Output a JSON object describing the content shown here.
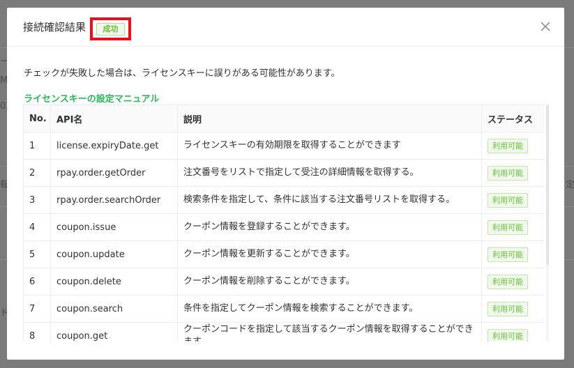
{
  "modal": {
    "title": "接続確認結果",
    "status_badge": "成功",
    "notice": "チェックが失敗した場合は、ライセンスキーに誤りがある可能性があります。",
    "manual_link": "ライセンスキーの設定マニュアル"
  },
  "table": {
    "headers": {
      "no": "No.",
      "api": "API名",
      "desc": "説明",
      "status": "ステータス"
    },
    "rows": [
      {
        "no": "1",
        "api": "license.expiryDate.get",
        "desc": "ライセンスキーの有効期限を取得することができます",
        "status": "利用可能"
      },
      {
        "no": "2",
        "api": "rpay.order.getOrder",
        "desc": "注文番号をリストで指定して受注の詳細情報を取得する。",
        "status": "利用可能"
      },
      {
        "no": "3",
        "api": "rpay.order.searchOrder",
        "desc": "検索条件を指定して、条件に該当する注文番号リストを取得する。",
        "status": "利用可能"
      },
      {
        "no": "4",
        "api": "coupon.issue",
        "desc": "クーポン情報を登録することができます。",
        "status": "利用可能"
      },
      {
        "no": "5",
        "api": "coupon.update",
        "desc": "クーポン情報を更新することができます。",
        "status": "利用可能"
      },
      {
        "no": "6",
        "api": "coupon.delete",
        "desc": "クーポン情報を削除することができます。",
        "status": "利用可能"
      },
      {
        "no": "7",
        "api": "coupon.search",
        "desc": "条件を指定してクーポン情報を検索することができます。",
        "status": "利用可能"
      },
      {
        "no": "8",
        "api": "coupon.get",
        "desc": "クーポンコードを指定して該当するクーポン情報を取得することができます。",
        "status": "利用可能"
      }
    ]
  },
  "background": {
    "frag1": "ー",
    "frag2": "M",
    "frag3": "02",
    "frag4": "報",
    "frag5": "定",
    "frag6": "ド"
  },
  "icons": {
    "close": "close-icon"
  },
  "colors": {
    "success": "#67c23a",
    "link": "#2fb45a",
    "highlight": "#e8101a"
  }
}
